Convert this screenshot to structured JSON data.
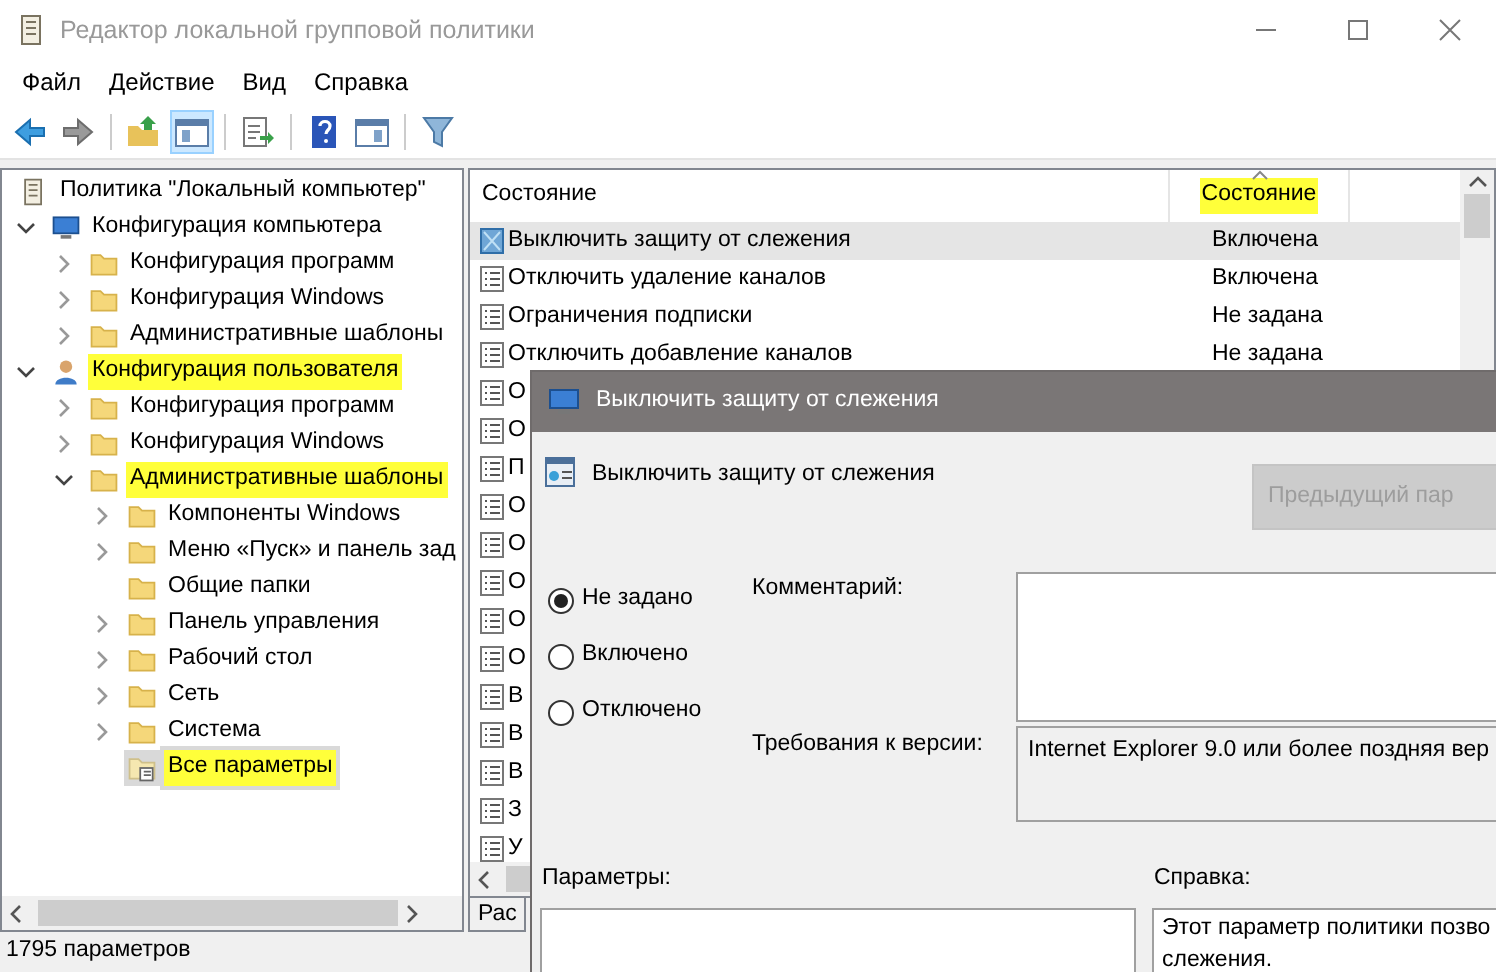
{
  "window": {
    "title": "Редактор локальной групповой политики",
    "active": false
  },
  "menu": [
    "Файл",
    "Действие",
    "Вид",
    "Справка"
  ],
  "toolbar": [
    {
      "kind": "button",
      "pressed": false
    },
    {
      "kind": "button",
      "pressed": false
    },
    {
      "kind": "separator"
    },
    {
      "kind": "button",
      "pressed": false
    },
    {
      "kind": "button",
      "pressed": true
    },
    {
      "kind": "separator"
    },
    {
      "kind": "button",
      "pressed": false
    },
    {
      "kind": "separator"
    },
    {
      "kind": "button",
      "pressed": false
    },
    {
      "kind": "button",
      "pressed": false
    },
    {
      "kind": "separator"
    },
    {
      "kind": "button",
      "pressed": false
    }
  ],
  "tree": [
    {
      "label": "Политика \"Локальный компьютер\"",
      "kind": "root",
      "highlighted": false,
      "selected": false,
      "children": [
        {
          "label": "Конфигурация компьютера",
          "kind": "computer",
          "expanded": true,
          "highlighted": false,
          "selected": false,
          "children": [
            {
              "label": "Конфигурация программ",
              "kind": "folder",
              "expanded": false,
              "highlighted": false,
              "selected": false
            },
            {
              "label": "Конфигурация Windows",
              "kind": "folder",
              "expanded": false,
              "highlighted": false,
              "selected": false
            },
            {
              "label": "Административные шаблоны",
              "kind": "folder",
              "expanded": false,
              "highlighted": false,
              "selected": false
            }
          ]
        },
        {
          "label": "Конфигурация пользователя",
          "kind": "user",
          "expanded": true,
          "highlighted": true,
          "selected": false,
          "children": [
            {
              "label": "Конфигурация программ",
              "kind": "folder",
              "expanded": false,
              "highlighted": false,
              "selected": false
            },
            {
              "label": "Конфигурация Windows",
              "kind": "folder",
              "expanded": false,
              "highlighted": false,
              "selected": false
            },
            {
              "label": "Административные шаблоны",
              "kind": "folder",
              "expanded": true,
              "highlighted": true,
              "selected": false,
              "children": [
                {
                  "label": "Компоненты Windows",
                  "kind": "folder",
                  "expanded": false,
                  "highlighted": false,
                  "selected": false
                },
                {
                  "label": "Меню «Пуск» и панель зад",
                  "kind": "folder",
                  "expanded": false,
                  "highlighted": false,
                  "selected": false
                },
                {
                  "label": "Общие папки",
                  "kind": "folder",
                  "highlighted": false,
                  "selected": false
                },
                {
                  "label": "Панель управления",
                  "kind": "folder",
                  "expanded": false,
                  "highlighted": false,
                  "selected": false
                },
                {
                  "label": "Рабочий стол",
                  "kind": "folder",
                  "expanded": false,
                  "highlighted": false,
                  "selected": false
                },
                {
                  "label": "Сеть",
                  "kind": "folder",
                  "expanded": false,
                  "highlighted": false,
                  "selected": false
                },
                {
                  "label": "Система",
                  "kind": "folder",
                  "expanded": false,
                  "highlighted": false,
                  "selected": false
                },
                {
                  "label": "Все параметры",
                  "kind": "settings",
                  "highlighted": true,
                  "selected": true
                }
              ]
            }
          ]
        }
      ]
    }
  ],
  "list": {
    "columns": [
      {
        "label": "Состояние",
        "highlighted": false,
        "sorted": false
      },
      {
        "label": "Состояние",
        "highlighted": true,
        "sorted": true
      }
    ],
    "rows": [
      {
        "name": "Выключить защиту от слежения",
        "status": "Включена",
        "selected": true
      },
      {
        "name": "Отключить удаление каналов",
        "status": "Включена",
        "selected": false
      },
      {
        "name": "Ограничения подписки",
        "status": "Не задана",
        "selected": false
      },
      {
        "name": "Отключить добавление каналов",
        "status": "Не задана",
        "selected": false
      },
      {
        "name": "О",
        "selected": false
      },
      {
        "name": "О",
        "selected": false
      },
      {
        "name": "П",
        "selected": false
      },
      {
        "name": "О",
        "selected": false
      },
      {
        "name": "О",
        "selected": false
      },
      {
        "name": "О",
        "selected": false
      },
      {
        "name": "О",
        "selected": false
      },
      {
        "name": "О",
        "selected": false
      },
      {
        "name": "В",
        "selected": false
      },
      {
        "name": "В",
        "selected": false
      },
      {
        "name": "В",
        "selected": false
      },
      {
        "name": "З",
        "selected": false
      },
      {
        "name": "У",
        "selected": false
      }
    ],
    "tabs": [
      {
        "label": "Рас",
        "selected": false
      }
    ]
  },
  "status_bar": "1795 параметров",
  "dialog": {
    "title": "Выключить защиту от слежения",
    "setting_name": "Выключить защиту от слежения",
    "prev_button": {
      "label": "Предыдущий пар",
      "disabled": true
    },
    "options": [
      {
        "label": "Не задано",
        "selected": true
      },
      {
        "label": "Включено",
        "selected": false
      },
      {
        "label": "Отключено",
        "selected": false
      }
    ],
    "comment_label": "Комментарий:",
    "version_label": "Требования к версии:",
    "version_value": "Internet Explorer 9.0 или более поздняя вер",
    "params_label": "Параметры:",
    "help_label": "Справка:",
    "help_lines": [
      "Этот параметр политики позво",
      "слежения."
    ]
  }
}
